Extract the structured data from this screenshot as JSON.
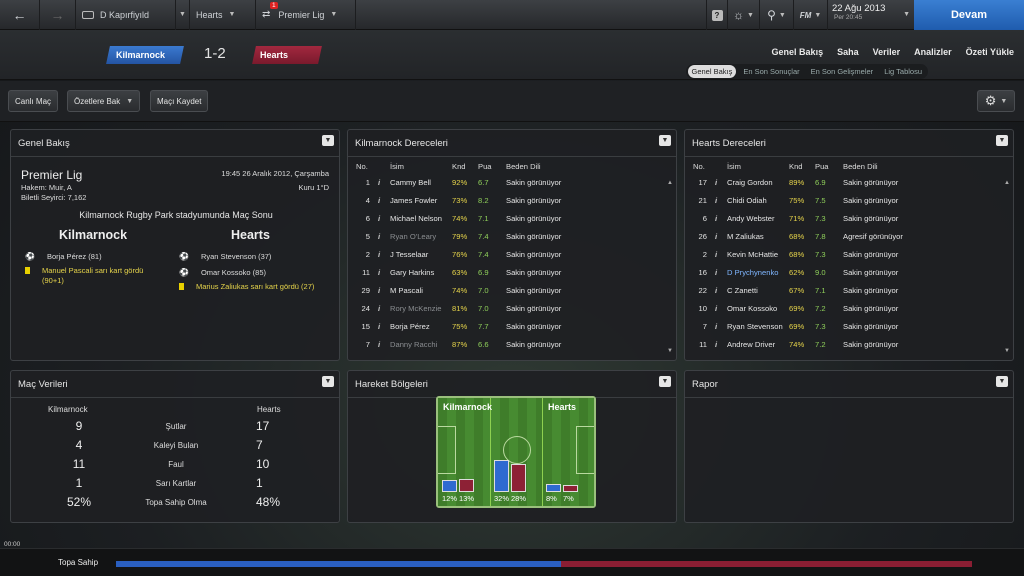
{
  "topbar": {
    "team": "D Kapırfiyıld",
    "competition": "Hearts",
    "league": "Premier Lig",
    "notification_count": "1",
    "help": "?",
    "fm_label": "FM",
    "date": "22 Ağu 2013",
    "day_time": "Per 20:45",
    "continue_label": "Devam",
    "accent_color": "#2a6ac0"
  },
  "header": {
    "home_team": "Kilmarnock",
    "away_team": "Hearts",
    "score": "1-2",
    "nav": [
      "Genel Bakış",
      "Saha",
      "Veriler",
      "Analizler",
      "Özeti Yükle"
    ],
    "subnav": [
      "Genel Bakış",
      "En Son Sonuçlar",
      "En Son Gelişmeler",
      "Lig Tablosu"
    ],
    "subnav_active": "Genel Bakış",
    "home_color": "#2f67bd",
    "away_color": "#8d2135"
  },
  "toolbar": {
    "live_match": "Canlı Maç",
    "view_highlights": "Özetlere Bak",
    "save_match": "Maçı Kaydet"
  },
  "overview": {
    "title": "Genel Bakış",
    "league": "Premier Lig",
    "datetime": "19:45 26 Aralık 2012, Çarşamba",
    "referee": "Hakem: Muir, A",
    "weather": "Kuru 1°D",
    "attendance": "Biletli Seyirci: 7,162",
    "venue": "Kilmarnock Rugby Park stadyumunda Maç Sonu",
    "home": "Kilmarnock",
    "away": "Hearts",
    "home_events": [
      {
        "icon": "goal-ball-icon",
        "text": "Borja Pérez (81)"
      },
      {
        "icon": "yellow-card-icon",
        "text": "Manuel Pascali sarı kart gördü (90+1)"
      }
    ],
    "away_events": [
      {
        "icon": "goal-ball-icon",
        "text": "Ryan Stevenson (37)"
      },
      {
        "icon": "goal-ball-icon",
        "text": "Omar Kossoko (85)"
      },
      {
        "icon": "yellow-card-icon",
        "text": "Marius Zaliukas sarı kart gördü (27)"
      }
    ]
  },
  "kil_ratings": {
    "title": "Kilmarnock Dereceleri",
    "headers": [
      "No.",
      "İsim",
      "Knd",
      "Pua",
      "Beden Dili"
    ],
    "rows": [
      {
        "no": "1",
        "name": "Cammy Bell",
        "knd": "92%",
        "pua": "6.7",
        "bd": "Sakin görünüyor",
        "dim": false
      },
      {
        "no": "4",
        "name": "James Fowler",
        "knd": "73%",
        "pua": "8.2",
        "bd": "Sakin görünüyor",
        "dim": false
      },
      {
        "no": "6",
        "name": "Michael Nelson",
        "knd": "74%",
        "pua": "7.1",
        "bd": "Sakin görünüyor",
        "dim": false
      },
      {
        "no": "5",
        "name": "Ryan O'Leary",
        "knd": "79%",
        "pua": "7.4",
        "bd": "Sakin görünüyor",
        "dim": true
      },
      {
        "no": "2",
        "name": "J Tesselaar",
        "knd": "76%",
        "pua": "7.4",
        "bd": "Sakin görünüyor",
        "dim": false
      },
      {
        "no": "11",
        "name": "Gary Harkins",
        "knd": "63%",
        "pua": "6.9",
        "bd": "Sakin görünüyor",
        "dim": false
      },
      {
        "no": "29",
        "name": "M Pascali",
        "knd": "74%",
        "pua": "7.0",
        "bd": "Sakin görünüyor",
        "dim": false
      },
      {
        "no": "24",
        "name": "Rory McKenzie",
        "knd": "81%",
        "pua": "7.0",
        "bd": "Sakin görünüyor",
        "dim": true
      },
      {
        "no": "15",
        "name": "Borja Pérez",
        "knd": "75%",
        "pua": "7.7",
        "bd": "Sakin görünüyor",
        "dim": false
      },
      {
        "no": "7",
        "name": "Danny Racchi",
        "knd": "87%",
        "pua": "6.6",
        "bd": "Sakin görünüyor",
        "dim": true
      }
    ]
  },
  "hearts_ratings": {
    "title": "Hearts Dereceleri",
    "headers": [
      "No.",
      "İsim",
      "Knd",
      "Pua",
      "Beden Dili"
    ],
    "rows": [
      {
        "no": "17",
        "name": "Craig Gordon",
        "knd": "89%",
        "pua": "6.9",
        "bd": "Sakin görünüyor",
        "dim": false
      },
      {
        "no": "21",
        "name": "Chidi Odiah",
        "knd": "75%",
        "pua": "7.5",
        "bd": "Sakin görünüyor",
        "dim": false
      },
      {
        "no": "6",
        "name": "Andy Webster",
        "knd": "71%",
        "pua": "7.3",
        "bd": "Sakin görünüyor",
        "dim": false
      },
      {
        "no": "26",
        "name": "M Zaliukas",
        "knd": "68%",
        "pua": "7.8",
        "bd": "Agresif görünüyor",
        "dim": false
      },
      {
        "no": "2",
        "name": "Kevin McHattie",
        "knd": "68%",
        "pua": "7.3",
        "bd": "Sakin görünüyor",
        "dim": false
      },
      {
        "no": "16",
        "name": "D Prychynenko",
        "knd": "62%",
        "pua": "9.0",
        "bd": "Sakin görünüyor",
        "dim": false,
        "highlight": true
      },
      {
        "no": "22",
        "name": "C Zanetti",
        "knd": "67%",
        "pua": "7.1",
        "bd": "Sakin görünüyor",
        "dim": false
      },
      {
        "no": "10",
        "name": "Omar Kossoko",
        "knd": "69%",
        "pua": "7.2",
        "bd": "Sakin görünüyor",
        "dim": false
      },
      {
        "no": "7",
        "name": "Ryan Stevenson",
        "knd": "69%",
        "pua": "7.3",
        "bd": "Sakin görünüyor",
        "dim": false
      },
      {
        "no": "11",
        "name": "Andrew Driver",
        "knd": "74%",
        "pua": "7.2",
        "bd": "Sakin görünüyor",
        "dim": false
      }
    ]
  },
  "match_stats": {
    "title": "Maç Verileri",
    "home": "Kilmarnock",
    "away": "Hearts",
    "rows": [
      {
        "home": "9",
        "label": "Şutlar",
        "away": "17"
      },
      {
        "home": "4",
        "label": "Kaleyi Bulan",
        "away": "7"
      },
      {
        "home": "11",
        "label": "Faul",
        "away": "10"
      },
      {
        "home": "1",
        "label": "Sarı Kartlar",
        "away": "1"
      },
      {
        "home": "52%",
        "label": "Topa Sahip Olma",
        "away": "48%"
      }
    ]
  },
  "zones": {
    "title": "Hareket Bölgeleri",
    "home": "Kilmarnock",
    "away": "Hearts",
    "segments": [
      {
        "home": 12,
        "away": 13,
        "home_label": "12%",
        "away_label": "13%"
      },
      {
        "home": 32,
        "away": 28,
        "home_label": "32%",
        "away_label": "28%"
      },
      {
        "home": 8,
        "away": 7,
        "home_label": "8%",
        "away_label": "7%"
      }
    ]
  },
  "report": {
    "title": "Rapor"
  },
  "footer": {
    "time": "00:00",
    "possession_label": "Topa Sahip",
    "home_possession": 52
  }
}
